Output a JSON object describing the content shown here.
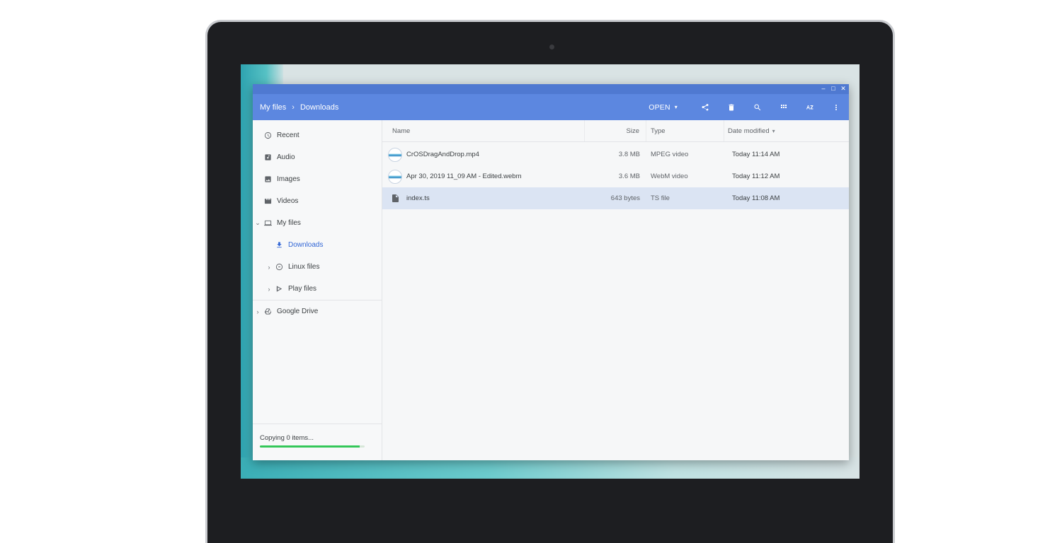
{
  "window": {
    "controls": {
      "minimize": "–",
      "maximize": "□",
      "close": "✕"
    }
  },
  "breadcrumb": {
    "root": "My files",
    "separator": "›",
    "current": "Downloads"
  },
  "toolbar": {
    "open_label": "OPEN",
    "open_caret": "▾",
    "icons": [
      "share-icon",
      "delete-icon",
      "search-icon",
      "grid-view-icon",
      "sort-az-icon",
      "more-vert-icon"
    ]
  },
  "sidebar": {
    "items": [
      {
        "label": "Recent",
        "icon": "clock-icon"
      },
      {
        "label": "Audio",
        "icon": "audio-icon"
      },
      {
        "label": "Images",
        "icon": "image-icon"
      },
      {
        "label": "Videos",
        "icon": "video-icon"
      },
      {
        "label": "My files",
        "icon": "laptop-icon",
        "expander": "⌄"
      },
      {
        "label": "Downloads",
        "icon": "download-icon",
        "active": true
      },
      {
        "label": "Linux files",
        "icon": "linux-icon",
        "expander": "›"
      },
      {
        "label": "Play files",
        "icon": "play-icon",
        "expander": "›"
      },
      {
        "label": "Google Drive",
        "icon": "drive-icon",
        "expander": "›"
      }
    ],
    "status": {
      "text": "Copying 0 items...",
      "progress": 0.95
    }
  },
  "table": {
    "headers": {
      "name": "Name",
      "size": "Size",
      "type": "Type",
      "date": "Date modified",
      "sort_indicator": "▾"
    },
    "rows": [
      {
        "name": "CrOSDragAndDrop.mp4",
        "size": "3.8 MB",
        "type": "MPEG video",
        "date": "Today 11:14 AM",
        "icon": "video-thumbnail"
      },
      {
        "name": "Apr 30, 2019 11_09 AM - Edited.webm",
        "size": "3.6 MB",
        "type": "WebM video",
        "date": "Today 11:12 AM",
        "icon": "video-thumbnail"
      },
      {
        "name": "index.ts",
        "size": "643 bytes",
        "type": "TS file",
        "date": "Today 11:08 AM",
        "icon": "file-icon",
        "selected": true
      }
    ]
  },
  "colors": {
    "toolbar": "#5c87e0",
    "titlebar": "#4f79d1",
    "accent": "#3367d6",
    "progress": "#34c759",
    "selected_row": "#dbe4f3"
  }
}
